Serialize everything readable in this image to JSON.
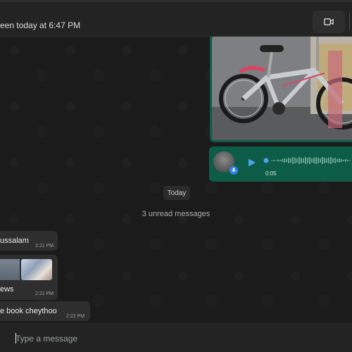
{
  "header": {
    "status": "een today at 6:47 PM",
    "video_icon": "video-camera-icon"
  },
  "messages": {
    "voice": {
      "duration": "0:05",
      "icon": "play-icon",
      "mic_icon": "mic-icon"
    },
    "date_divider": "Today",
    "unread_divider": "3 unread messages",
    "incoming": [
      {
        "text": "ussalam",
        "time": "2:21 PM"
      },
      {
        "text": "ews",
        "time": "2:21 PM"
      },
      {
        "text": "e book cheythoo",
        "time": "2:22 PM"
      }
    ]
  },
  "composer": {
    "placeholder": "Type a message"
  },
  "colors": {
    "outgoing": "#0d5c47",
    "incoming": "#2e2e2e",
    "accent": "#2f86e6"
  }
}
